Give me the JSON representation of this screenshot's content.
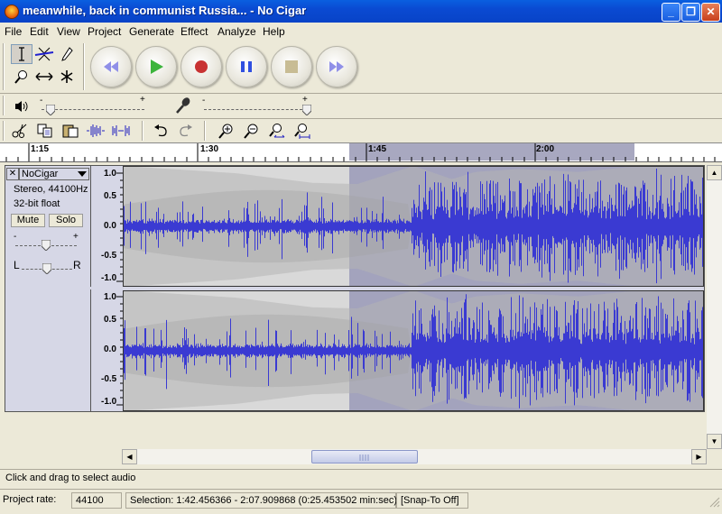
{
  "window": {
    "title": "meanwhile, back in communist Russia... - No Cigar",
    "minimize": "_",
    "maximize": "❐",
    "close": "✕"
  },
  "menu": [
    "File",
    "Edit",
    "View",
    "Project",
    "Generate",
    "Effect",
    "Analyze",
    "Help"
  ],
  "tools": {
    "selection": "selection-tool-icon",
    "envelope": "envelope-tool-icon",
    "draw": "draw-tool-icon",
    "zoom": "zoom-tool-icon",
    "timeshift": "timeshift-tool-icon",
    "multi": "multi-tool-icon"
  },
  "transport": [
    "skip-start-icon",
    "play-icon",
    "record-icon",
    "pause-icon",
    "stop-icon",
    "skip-end-icon"
  ],
  "mixer": {
    "output_minus": "-",
    "output_plus": "+",
    "input_minus": "-",
    "input_plus": "+",
    "output_volume": 0.1,
    "input_volume": 1.0
  },
  "ruler": {
    "labels": [
      "1:15",
      "1:30",
      "1:45",
      "2:00"
    ]
  },
  "track": {
    "close": "✕",
    "name": "NoCigar",
    "format": "Stereo, 44100Hz",
    "bitdepth": "32-bit float",
    "mute": "Mute",
    "solo": "Solo",
    "gain_minus": "-",
    "gain_plus": "+",
    "pan_left": "L",
    "pan_right": "R",
    "vticks": [
      "1.0",
      "0.5",
      "0.0",
      "-0.5",
      "-1.0"
    ]
  },
  "status": {
    "hint": "Click and drag to select audio",
    "rate_label": "Project rate:",
    "rate_value": "44100",
    "selection": "Selection: 1:42.456366 - 2:07.909868 (0:25.453502 min:sec)",
    "snap": "[Snap-To Off]"
  },
  "colors": {
    "waveform": "#3a3ad2",
    "selection_bg": "#a3a3bd",
    "track_bg": "#d6d7e6",
    "envelope_bg": "#ffffff"
  }
}
